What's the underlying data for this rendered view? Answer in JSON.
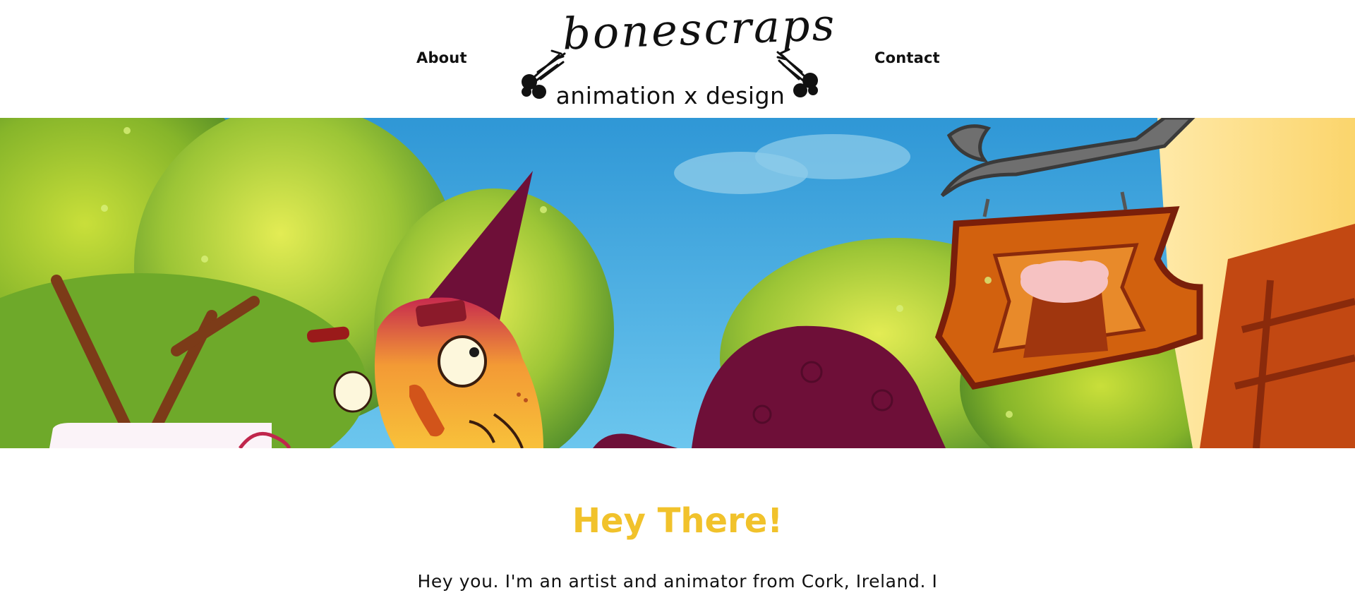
{
  "header": {
    "nav": {
      "about": "About",
      "contact": "Contact"
    },
    "logo": {
      "wordmark": "bonescraps",
      "tagline": "animation x design"
    }
  },
  "hero": {
    "image_alt": "Illustration of a cartoon wizard character leaning forward beneath a hanging tavern sign with a beer mug, trees and blue sky behind"
  },
  "main": {
    "heading": "Hey There!",
    "intro_text": "Hey you. I'm an artist and animator from Cork, Ireland. I"
  },
  "colors": {
    "accent_heading": "#f1c22b",
    "text": "#111111",
    "sky": "#3aa3dd",
    "foliage": "#7bb52a",
    "wizard_robe": "#6e0f38",
    "sign_wood": "#d2610e"
  }
}
